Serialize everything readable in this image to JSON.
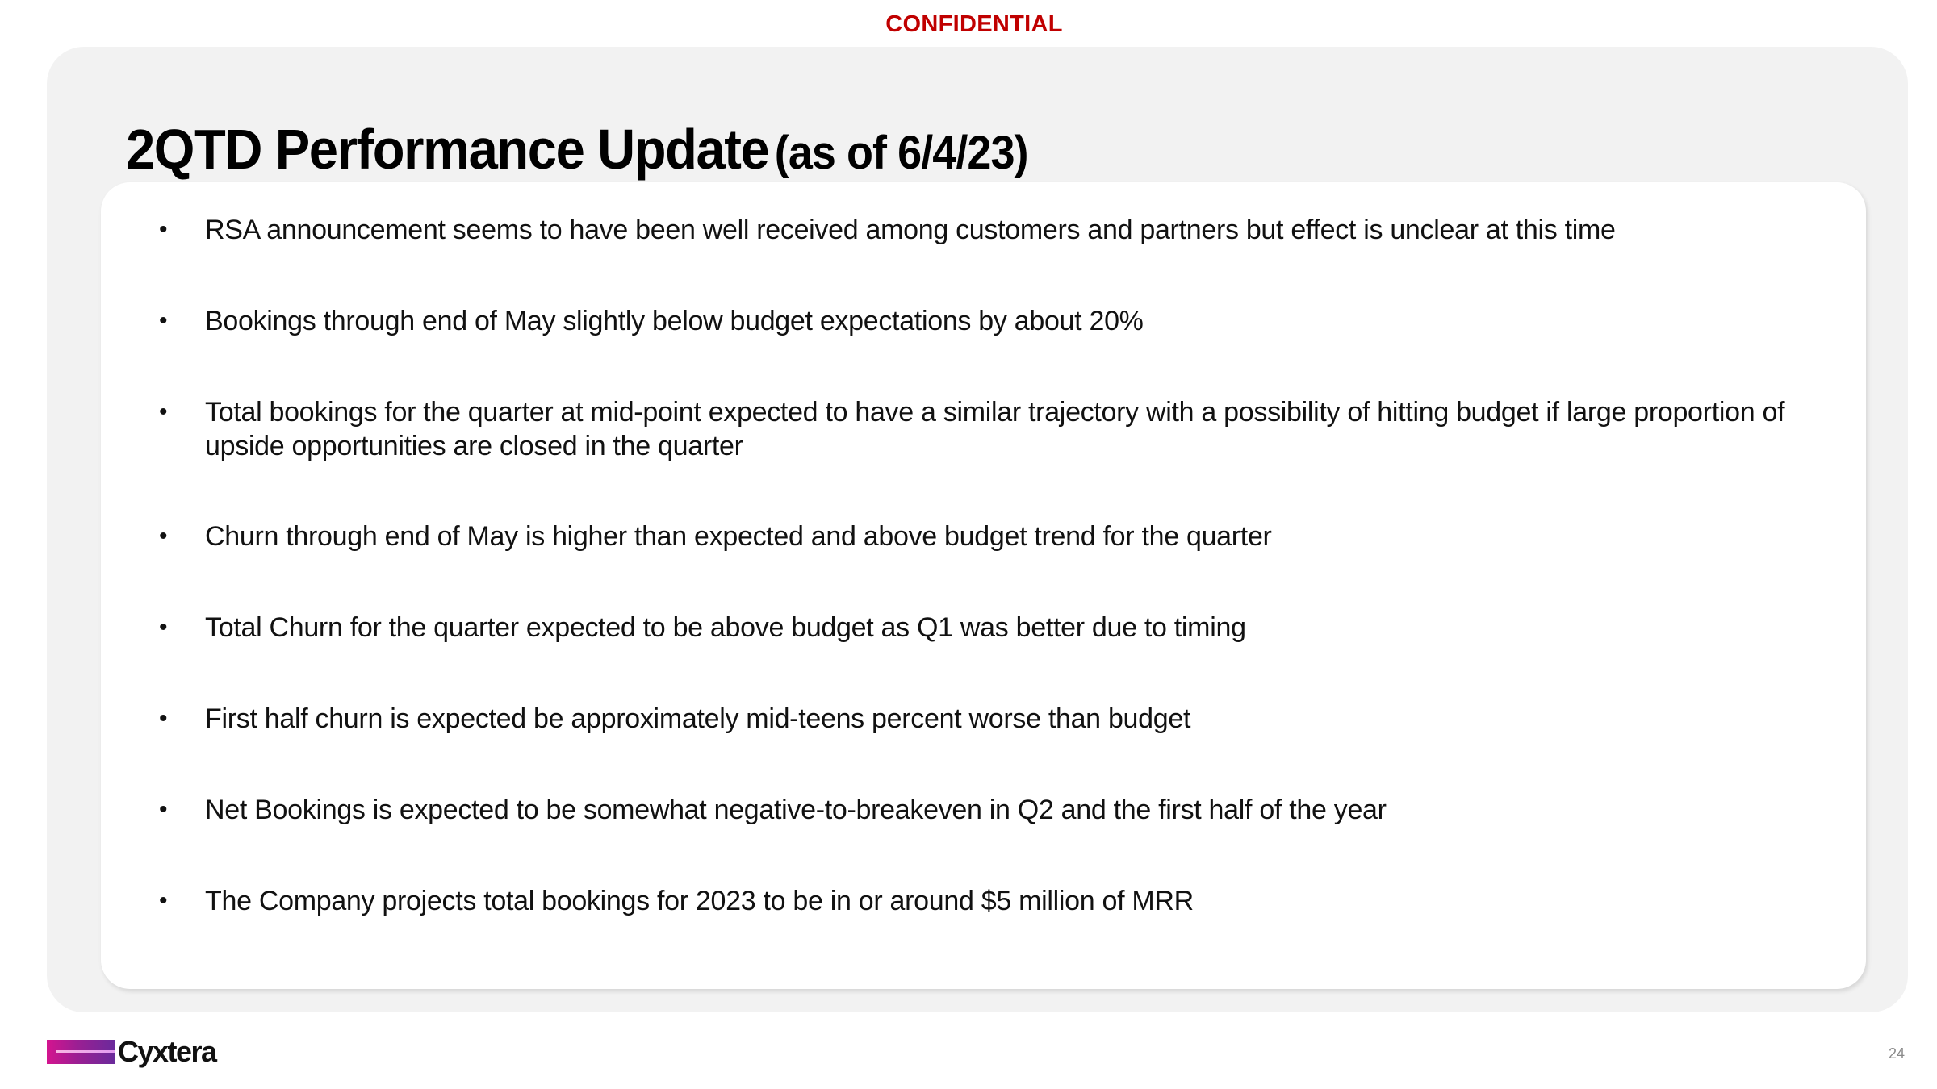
{
  "header": {
    "confidential_label": "CONFIDENTIAL"
  },
  "title": {
    "main": "2QTD Performance Update",
    "sub": "(as of 6/4/23)"
  },
  "bullets": [
    {
      "text": "RSA announcement seems to have been well received among customers and partners but effect is unclear at this time"
    },
    {
      "text": "Bookings through end of May slightly below budget expectations by about 20%"
    },
    {
      "text": "Total bookings for the quarter at mid-point expected to have a similar trajectory with a possibility of hitting budget if large proportion of upside opportunities are closed in the quarter"
    },
    {
      "text": "Churn through end of May is higher than expected and above budget trend for the quarter"
    },
    {
      "text": "Total Churn for the quarter expected to be above budget as Q1 was better due to timing"
    },
    {
      "text": "First half churn is expected be approximately mid-teens percent worse than budget"
    },
    {
      "text": "Net Bookings is expected to be somewhat negative-to-breakeven in Q2 and the first half of the year"
    },
    {
      "text": "The Company projects total bookings for 2023 to be in or around $5 million of MRR"
    }
  ],
  "bullet_glyph": "•",
  "footer": {
    "logo_text": "Cyxtera",
    "logo_icon": "cyxtera-logo-mark",
    "page_number": "24"
  },
  "colors": {
    "confidential": "#c00000",
    "panel_bg": "#f2f2f2",
    "card_bg": "#ffffff",
    "logo_gradient_start": "#d4148f",
    "logo_gradient_end": "#6a2a9b"
  }
}
